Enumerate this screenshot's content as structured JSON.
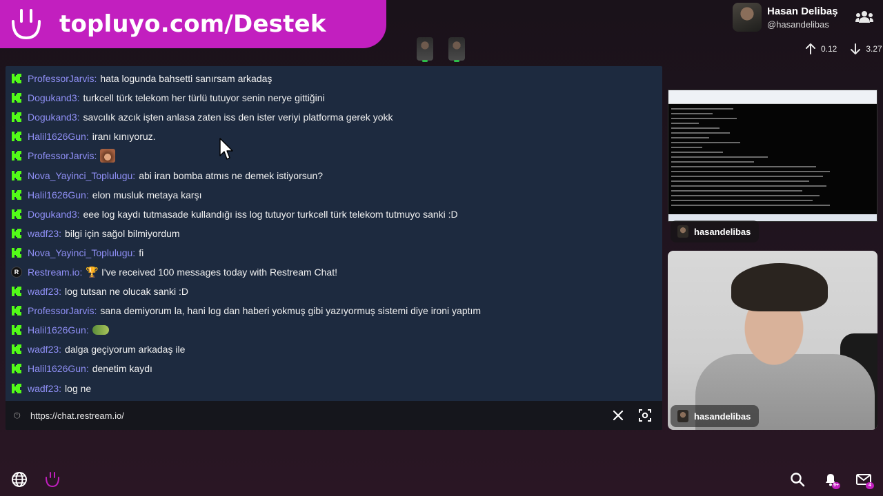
{
  "promo": {
    "text": "topluyo.com/Destek"
  },
  "profile": {
    "name": "Hasan Delibaş",
    "handle": "@hasandelibas"
  },
  "stats": {
    "upload": "0.12",
    "download": "3.27"
  },
  "chat": {
    "messages": [
      {
        "platform": "kick",
        "user": "ProfessorJarvis",
        "text": "hata logunda bahsetti sanırsam arkadaş"
      },
      {
        "platform": "kick",
        "user": "Dogukand3",
        "text": "turkcell türk telekom her türlü tutuyor senin nerye gittiğini"
      },
      {
        "platform": "kick",
        "user": "Dogukand3",
        "text": "savcılık azcık işten anlasa zaten iss den ister veriyi platforma gerek yokk"
      },
      {
        "platform": "kick",
        "user": "Halil1626Gun",
        "text": "iranı kınıyoruz."
      },
      {
        "platform": "kick",
        "user": "ProfessorJarvis",
        "text": "",
        "emote": "face"
      },
      {
        "platform": "kick",
        "user": "Nova_Yayinci_Toplulugu",
        "text": "abi iran bomba atmıs ne demek istiyorsun?"
      },
      {
        "platform": "kick",
        "user": "Halil1626Gun",
        "text": "elon musluk metaya karşı"
      },
      {
        "platform": "kick",
        "user": "Dogukand3",
        "text": "eee log kaydı tutmasade kullandığı iss log tutuyor turkcell türk telekom tutmuyo sanki :D"
      },
      {
        "platform": "kick",
        "user": "wadf23",
        "text": "bilgi için sağol bilmiyordum"
      },
      {
        "platform": "kick",
        "user": "Nova_Yayinci_Toplulugu",
        "text": "fi"
      },
      {
        "platform": "restream",
        "user": "Restream.io",
        "text": "I've received 100 messages today with Restream Chat!",
        "trophy": true
      },
      {
        "platform": "kick",
        "user": "wadf23",
        "text": "log tutsan ne olucak sanki :D"
      },
      {
        "platform": "kick",
        "user": "ProfessorJarvis",
        "text": "sana demiyorum la, hani log dan haberi yokmuş gibi yazıyormuş sistemi diye ironi yaptım"
      },
      {
        "platform": "kick",
        "user": "Halil1626Gun",
        "text": "",
        "emote": "croc"
      },
      {
        "platform": "kick",
        "user": "wadf23",
        "text": "dalga geçiyorum arkadaş ile"
      },
      {
        "platform": "kick",
        "user": "Halil1626Gun",
        "text": "denetim kaydı"
      },
      {
        "platform": "kick",
        "user": "wadf23",
        "text": "log ne"
      }
    ],
    "footer_url": "https://chat.restream.io/"
  },
  "tiles": {
    "screen_name": "hasandelibas",
    "cam_name": "hasandelibas"
  },
  "bottom": {
    "notification_badge": "9+",
    "mail_badge": "4"
  },
  "colors": {
    "brand": "#c21fbf",
    "chat_bg": "#1d2a3f",
    "username": "#8f8ff5",
    "kick_green": "#53fc18"
  }
}
